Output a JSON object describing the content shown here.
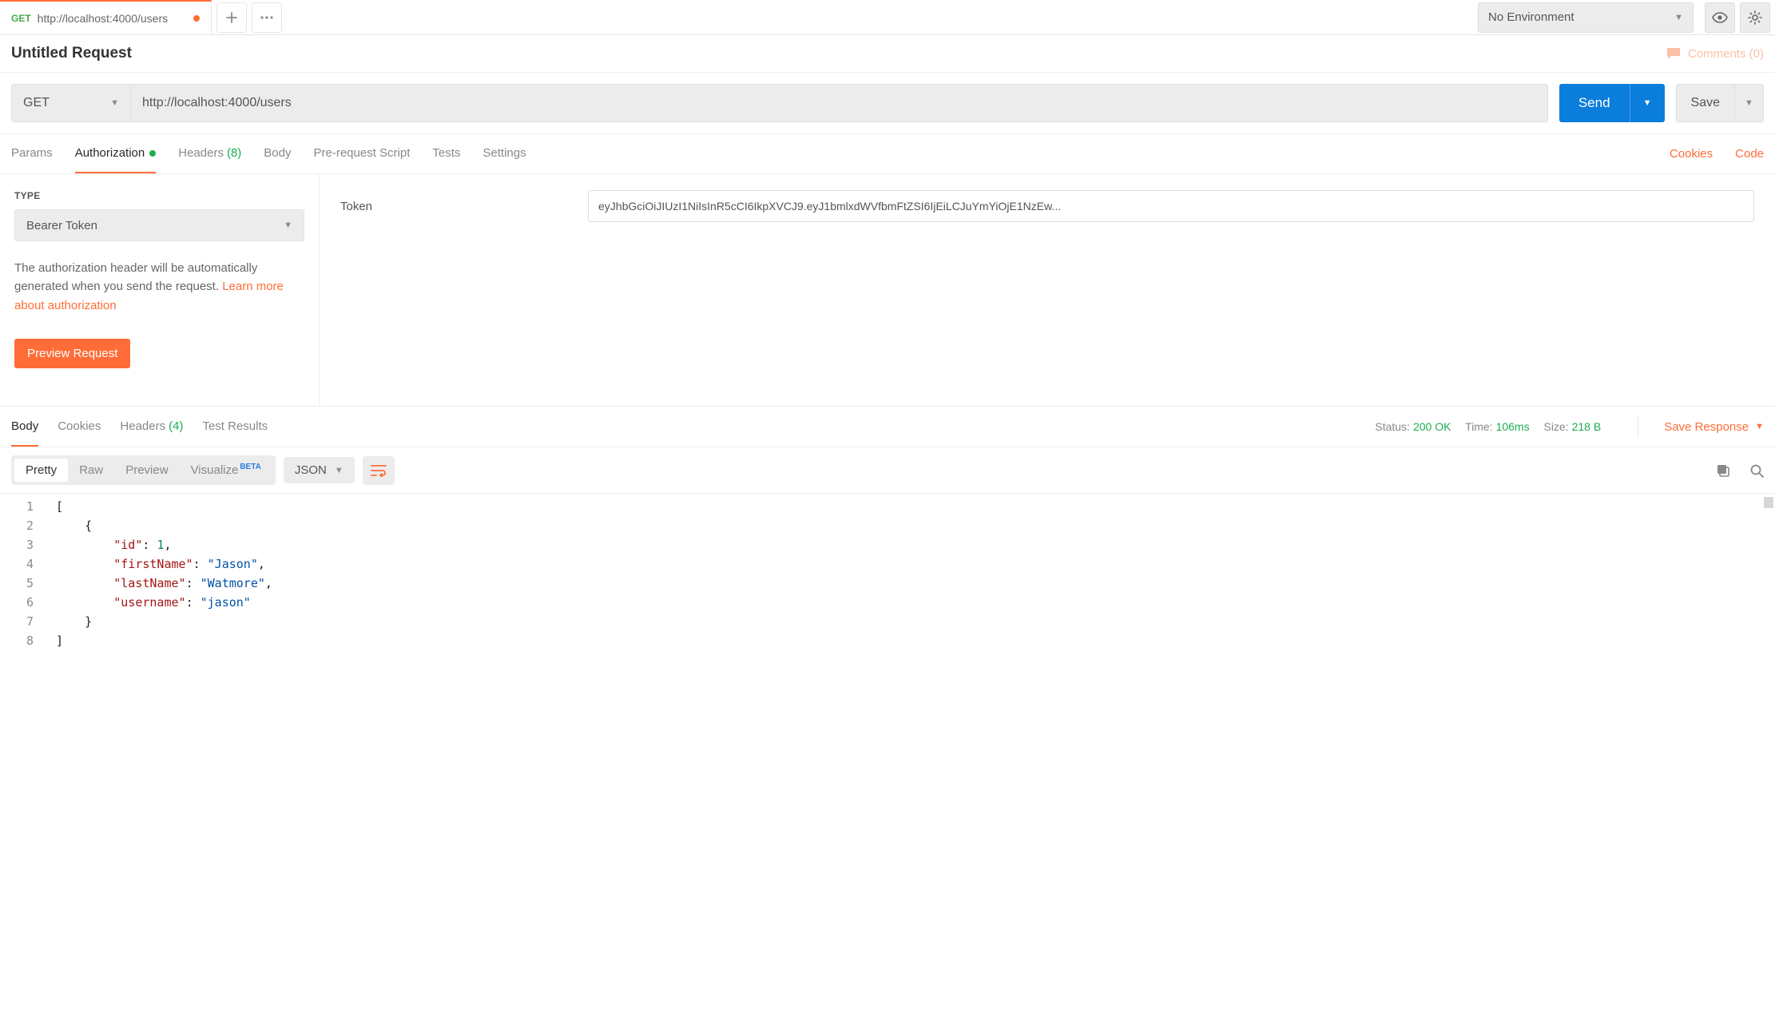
{
  "tab": {
    "method": "GET",
    "title": "http://localhost:4000/users"
  },
  "env": {
    "selected": "No Environment"
  },
  "requestTitle": "Untitled Request",
  "comments": {
    "label": "Comments",
    "count": 0
  },
  "urlbar": {
    "method": "GET",
    "url": "http://localhost:4000/users",
    "send": "Send",
    "save": "Save"
  },
  "reqTabs": {
    "params": "Params",
    "authorization": "Authorization",
    "headers": "Headers",
    "headersCount": "(8)",
    "body": "Body",
    "prerequest": "Pre-request Script",
    "tests": "Tests",
    "settings": "Settings",
    "cookies": "Cookies",
    "code": "Code"
  },
  "auth": {
    "typeLabel": "TYPE",
    "typeValue": "Bearer Token",
    "desc1": "The authorization header will be automatically generated when you send the request. ",
    "learnMore": "Learn more about authorization",
    "preview": "Preview Request",
    "tokenLabel": "Token",
    "tokenValue": "eyJhbGciOiJIUzI1NiIsInR5cCI6IkpXVCJ9.eyJ1bmlxdWVfbmFtZSI6IjEiLCJuYmYiOjE1NzEw..."
  },
  "respTabs": {
    "body": "Body",
    "cookies": "Cookies",
    "headers": "Headers",
    "headersCount": "(4)",
    "testResults": "Test Results"
  },
  "respMeta": {
    "statusLabel": "Status:",
    "statusValue": "200 OK",
    "timeLabel": "Time:",
    "timeValue": "106ms",
    "sizeLabel": "Size:",
    "sizeValue": "218 B",
    "saveResponse": "Save Response"
  },
  "viewer": {
    "pretty": "Pretty",
    "raw": "Raw",
    "preview": "Preview",
    "visualize": "Visualize",
    "beta": "BETA",
    "format": "JSON"
  },
  "responseBody": {
    "lines": [
      {
        "n": 1,
        "indent": 0,
        "tokens": [
          {
            "t": "p",
            "v": "["
          }
        ]
      },
      {
        "n": 2,
        "indent": 1,
        "tokens": [
          {
            "t": "p",
            "v": "{"
          }
        ]
      },
      {
        "n": 3,
        "indent": 2,
        "tokens": [
          {
            "t": "k",
            "v": "\"id\""
          },
          {
            "t": "p",
            "v": ": "
          },
          {
            "t": "n",
            "v": "1"
          },
          {
            "t": "p",
            "v": ","
          }
        ]
      },
      {
        "n": 4,
        "indent": 2,
        "tokens": [
          {
            "t": "k",
            "v": "\"firstName\""
          },
          {
            "t": "p",
            "v": ": "
          },
          {
            "t": "s",
            "v": "\"Jason\""
          },
          {
            "t": "p",
            "v": ","
          }
        ]
      },
      {
        "n": 5,
        "indent": 2,
        "tokens": [
          {
            "t": "k",
            "v": "\"lastName\""
          },
          {
            "t": "p",
            "v": ": "
          },
          {
            "t": "s",
            "v": "\"Watmore\""
          },
          {
            "t": "p",
            "v": ","
          }
        ]
      },
      {
        "n": 6,
        "indent": 2,
        "tokens": [
          {
            "t": "k",
            "v": "\"username\""
          },
          {
            "t": "p",
            "v": ": "
          },
          {
            "t": "s",
            "v": "\"jason\""
          }
        ]
      },
      {
        "n": 7,
        "indent": 1,
        "tokens": [
          {
            "t": "p",
            "v": "}"
          }
        ]
      },
      {
        "n": 8,
        "indent": 0,
        "tokens": [
          {
            "t": "p",
            "v": "]"
          }
        ]
      }
    ]
  }
}
